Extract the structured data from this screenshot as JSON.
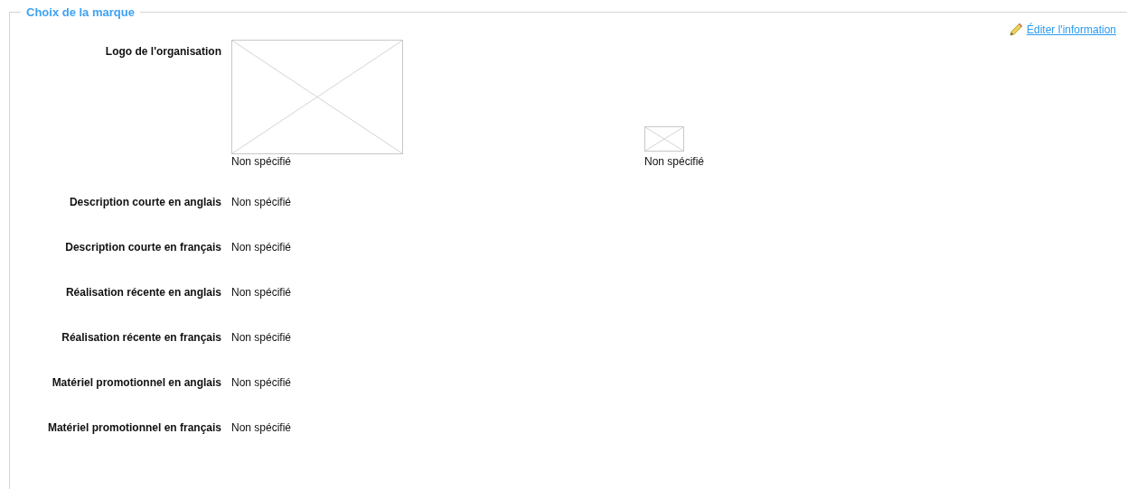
{
  "section": {
    "legend": "Choix de la marque",
    "edit_link": "Éditer l'information"
  },
  "logo": {
    "label": "Logo de l'organisation",
    "value": "Non spécifié",
    "preview_value": "Non spécifié"
  },
  "fields": [
    {
      "label": "Description courte en anglais",
      "value": "Non spécifié"
    },
    {
      "label": "Description courte en français",
      "value": "Non spécifié"
    },
    {
      "label": "Réalisation récente en anglais",
      "value": "Non spécifié"
    },
    {
      "label": "Réalisation récente en français",
      "value": "Non spécifié"
    },
    {
      "label": "Matériel promotionnel en anglais",
      "value": "Non spécifié"
    },
    {
      "label": "Matériel promotionnel en français",
      "value": "Non spécifié"
    }
  ]
}
